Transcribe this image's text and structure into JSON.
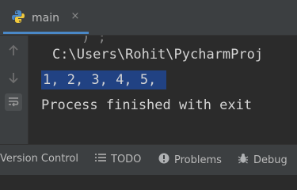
{
  "tab": {
    "label": "main",
    "close": "×"
  },
  "console": {
    "partial_line": "     ) ;",
    "path": "C:\\Users\\Rohit\\PycharmProj",
    "output": "1, 2, 3, 4, 5, ",
    "exit_text": "Process finished with exit"
  },
  "statusbar": {
    "version_control": "Version Control",
    "todo": "TODO",
    "problems": "Problems",
    "debug": "Debug"
  },
  "colors": {
    "accent": "#4a88c7",
    "selection": "#214283",
    "background": "#2b2b2b",
    "panel": "#3c3f41"
  }
}
